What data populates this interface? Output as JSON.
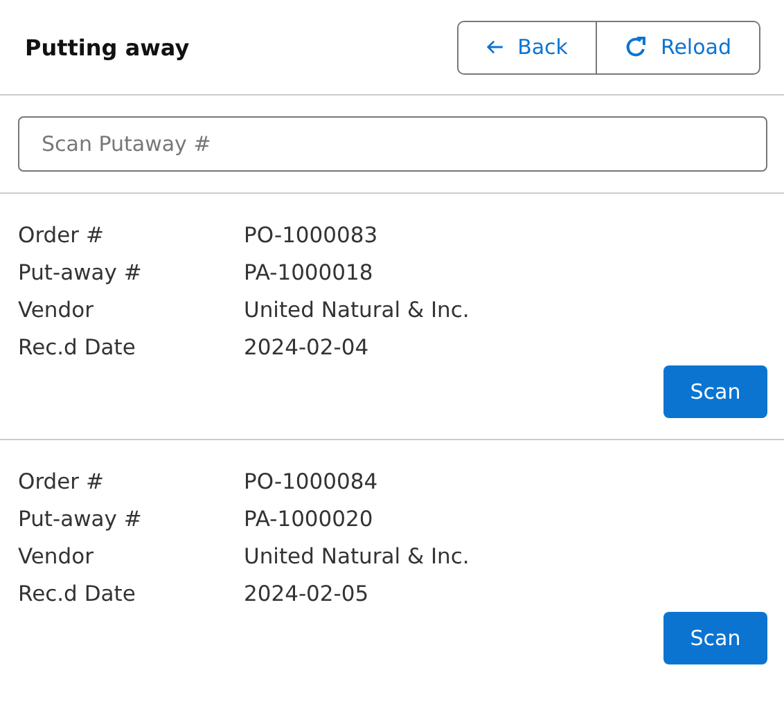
{
  "header": {
    "title": "Putting away",
    "buttons": [
      {
        "kind": "back",
        "label": "Back"
      },
      {
        "kind": "reload",
        "label": "Reload"
      }
    ]
  },
  "search": {
    "placeholder": "Scan Putaway #"
  },
  "orders": [
    {
      "fields": [
        {
          "label": "Order #",
          "value": "PO-1000083"
        },
        {
          "label": "Put-away #",
          "value": "PA-1000018"
        },
        {
          "label": "Vendor",
          "value": "United Natural & Inc."
        },
        {
          "label": "Rec.d Date",
          "value": "2024-02-04"
        }
      ],
      "action": "Scan"
    },
    {
      "fields": [
        {
          "label": "Order #",
          "value": "PO-1000084"
        },
        {
          "label": "Put-away #",
          "value": "PA-1000020"
        },
        {
          "label": "Vendor",
          "value": "United Natural & Inc."
        },
        {
          "label": "Rec.d Date",
          "value": "2024-02-05"
        }
      ],
      "action": "Scan"
    }
  ]
}
